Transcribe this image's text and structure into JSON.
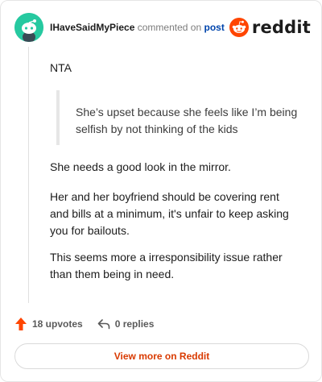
{
  "header": {
    "username": "IHaveSaidMyPiece",
    "commented_text": "commented on",
    "post_link": "post",
    "brand": "reddit",
    "brand_color": "#ff4500",
    "avatar_icon": "snoo-avatar-icon"
  },
  "comment": {
    "line1": "NTA",
    "quote": "She’s upset because she feels like I’m being selfish by not thinking of the kids",
    "paragraphs": [
      "She needs a good look in the mirror.",
      "Her and her boyfriend should be covering rent and bills at a minimum, it's unfair to keep asking you for bailouts.",
      "This seems more a irresponsibility issue rather than them being in need."
    ]
  },
  "actions": {
    "upvotes": "18 upvotes",
    "replies": "0 replies",
    "upvote_icon": "upvote-arrow-icon",
    "reply_icon": "reply-arrow-icon"
  },
  "footer": {
    "view_more": "View more on Reddit"
  }
}
